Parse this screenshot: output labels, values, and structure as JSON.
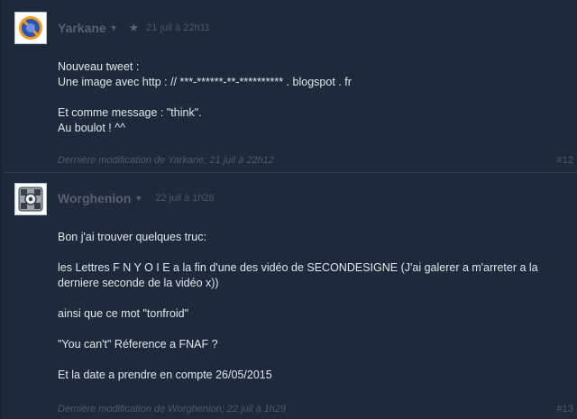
{
  "posts": [
    {
      "author": "Yarkane",
      "date": "21 juil à 22h11",
      "avatar_icon": "blue-circle-slash-icon",
      "paragraphs": [
        [
          "Nouveau tweet :",
          "Une image avec http : // ***-******-**-********** . blogspot . fr"
        ],
        [
          "Et comme message : \"think\".",
          "Au boulot ! ^^"
        ]
      ],
      "edit_note": "Dernière modification de Yarkane; 21 juil à 22h12",
      "number": "#12"
    },
    {
      "author": "Worghenion",
      "date": "22 juil à 1h26",
      "avatar_icon": "companion-cube-icon",
      "paragraphs": [
        [
          "Bon j'ai trouver quelques truc:"
        ],
        [
          "les Lettres F N Y O I E a la fin d'une des vidéo de SECONDESIGNE (J'ai galerer a m'arreter a la derniere seconde de la vidéo x))"
        ],
        [
          "ainsi que ce mot \"tonfroid\""
        ],
        [
          "\"You can't\" Réference a FNAF ?"
        ],
        [
          "Et la date a prendre en compte 26/05/2015"
        ]
      ],
      "edit_note": "Dernière modification de Worghenion; 22 juil à 1h29",
      "number": "#13"
    }
  ],
  "colors": {
    "background": "#1a2636",
    "post_bg": "#1d2a3b",
    "text": "#e2e6ea",
    "muted": "#4f5968"
  }
}
